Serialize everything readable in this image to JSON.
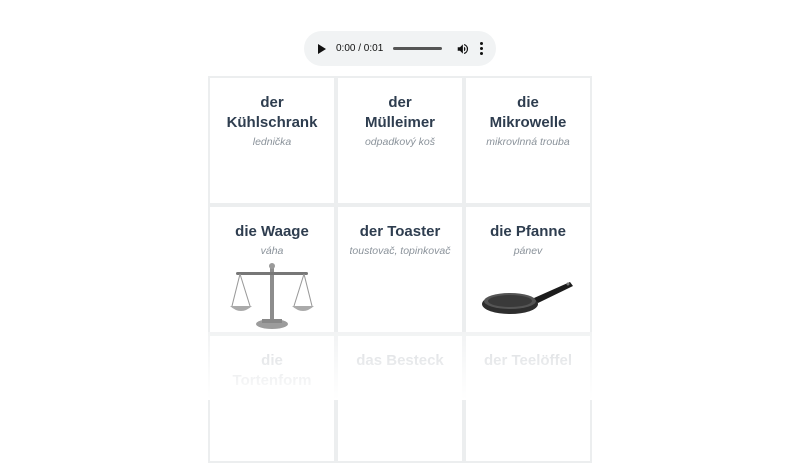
{
  "audio": {
    "time": "0:00 / 0:01",
    "play_icon": "play-icon",
    "volume_icon": "volume-icon",
    "more_icon": "more-vert-icon"
  },
  "cards": [
    {
      "word": "der Kühlschrank",
      "translation": "lednička"
    },
    {
      "word": "der Mülleimer",
      "translation": "odpadkový koš"
    },
    {
      "word": "die Mikrowelle",
      "translation": "mikrovlnná trouba"
    },
    {
      "word": "die Waage",
      "translation": "váha",
      "image": "scale-image"
    },
    {
      "word": "der Toaster",
      "translation": "toustovač, topinkovač"
    },
    {
      "word": "die Pfanne",
      "translation": "pánev",
      "image": "frying-pan-image"
    },
    {
      "word": "die Tortenform",
      "translation": ""
    },
    {
      "word": "das Besteck",
      "translation": ""
    },
    {
      "word": "der Teelöffel",
      "translation": ""
    }
  ]
}
